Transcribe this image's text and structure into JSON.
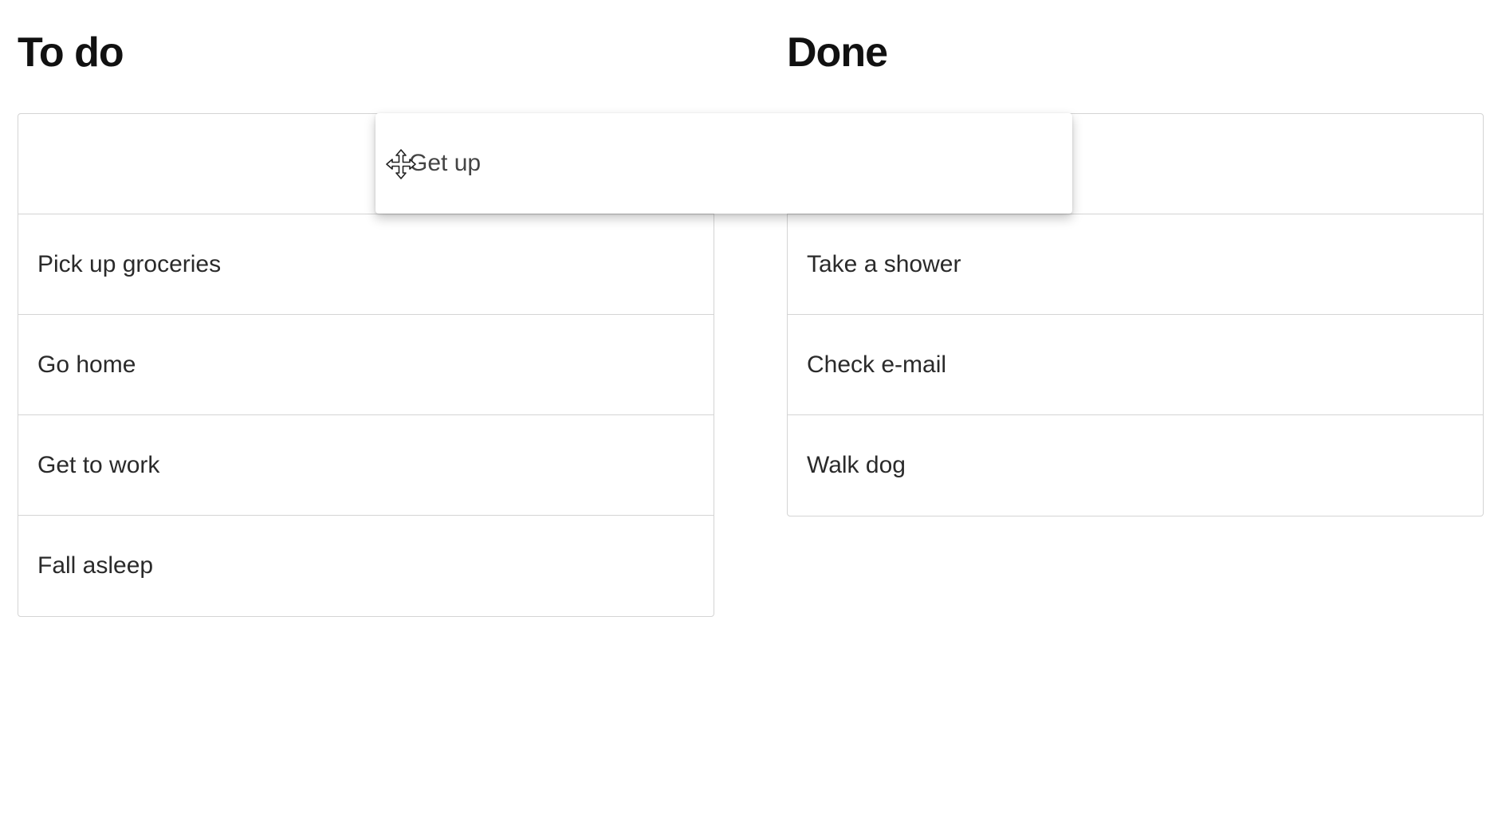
{
  "columns": {
    "todo": {
      "title": "To do",
      "items": [
        "Pick up groceries",
        "Go home",
        "Get to work",
        "Fall asleep"
      ]
    },
    "done": {
      "title": "Done",
      "items": [
        "Take a shower",
        "Check e-mail",
        "Walk dog"
      ]
    }
  },
  "dragging": {
    "label": "Get up",
    "cursor_icon": "move-cursor-icon"
  }
}
